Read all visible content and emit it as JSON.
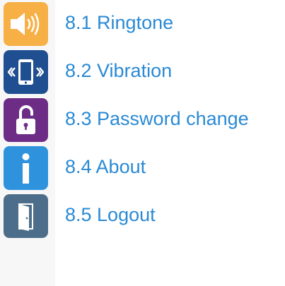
{
  "colors": {
    "label": "#2a8ad4",
    "ringtone_tile": "#f6b045",
    "vibration_tile": "#1f4f90",
    "password_tile": "#6d2d86",
    "about_tile": "#2e92dd",
    "logout_tile": "#4d6e8a",
    "side_strip": "#f7f7f8"
  },
  "menu": {
    "items": [
      {
        "label": "8.1 Ringtone",
        "icon": "speaker-icon"
      },
      {
        "label": "8.2 Vibration",
        "icon": "vibrating-phone-icon"
      },
      {
        "label": "8.3 Password change",
        "icon": "unlocked-padlock-icon"
      },
      {
        "label": "8.4 About",
        "icon": "info-icon"
      },
      {
        "label": "8.5 Logout",
        "icon": "door-icon"
      }
    ]
  }
}
